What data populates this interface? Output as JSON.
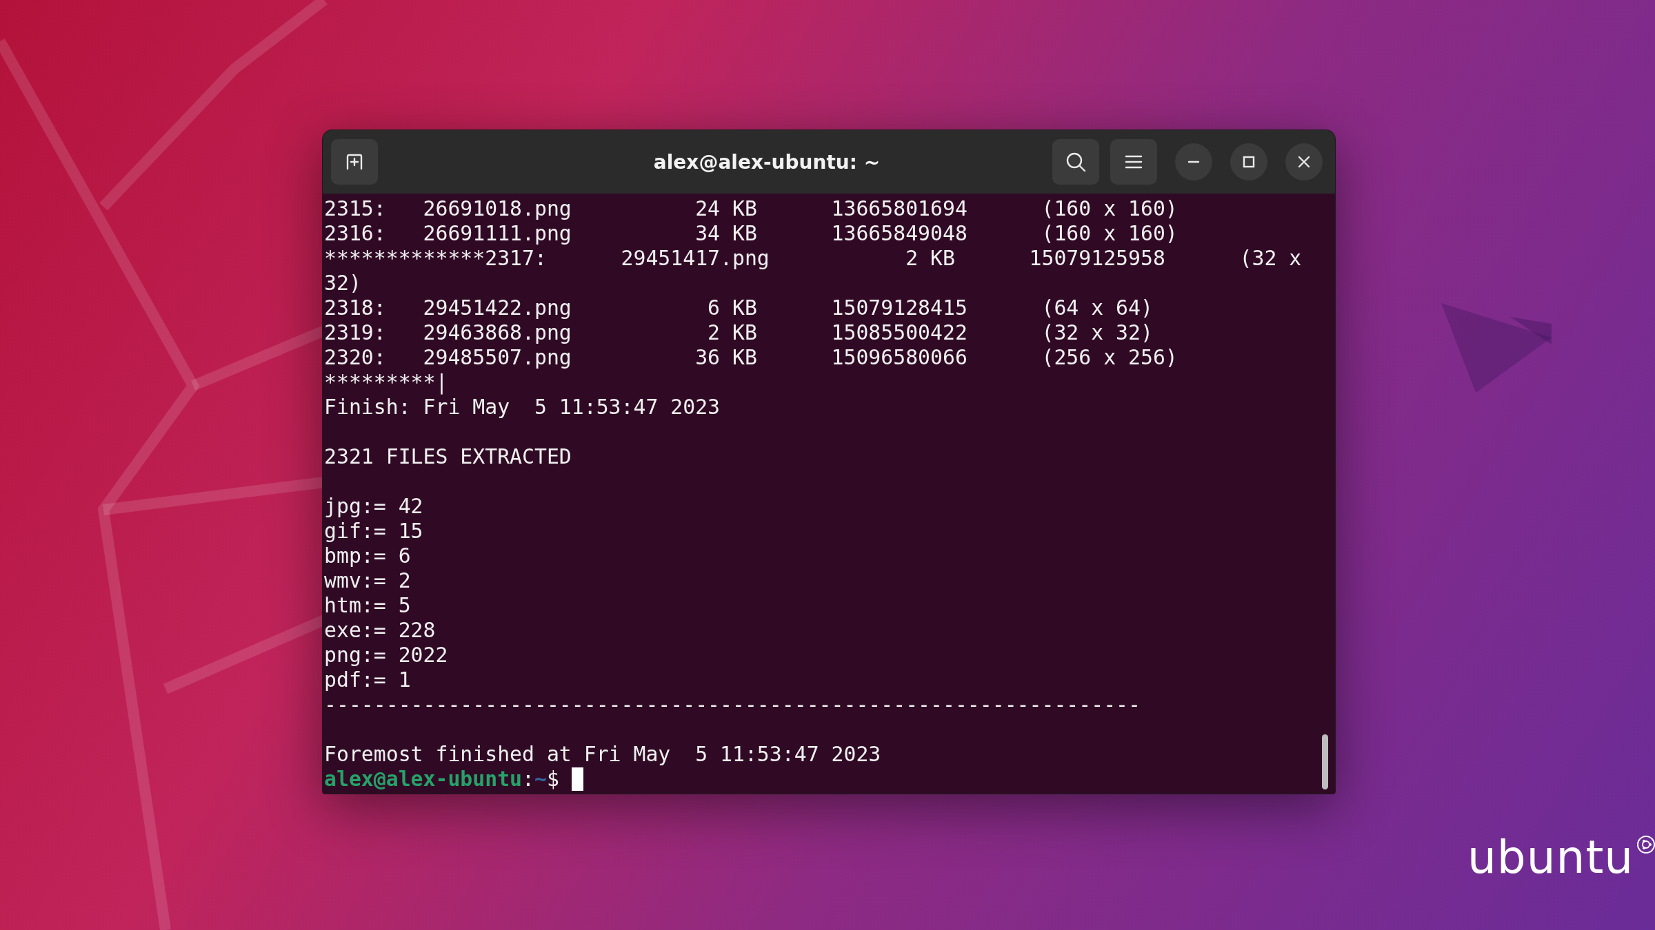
{
  "window": {
    "title": "alex@alex-ubuntu: ~"
  },
  "terminal": {
    "lines": [
      {
        "kind": "text",
        "text": "2315:   26691018.png          24 KB      13665801694      (160 x 160)"
      },
      {
        "kind": "text",
        "text": "2316:   26691111.png          34 KB      13665849048      (160 x 160)"
      },
      {
        "kind": "text",
        "text": "*************2317:      29451417.png           2 KB      15079125958      (32 x"
      },
      {
        "kind": "text",
        "text": "32)"
      },
      {
        "kind": "text",
        "text": "2318:   29451422.png           6 KB      15079128415      (64 x 64)"
      },
      {
        "kind": "text",
        "text": "2319:   29463868.png           2 KB      15085500422      (32 x 32)"
      },
      {
        "kind": "text",
        "text": "2320:   29485507.png          36 KB      15096580066      (256 x 256)"
      },
      {
        "kind": "text",
        "text": "*********|"
      },
      {
        "kind": "text",
        "text": "Finish: Fri May  5 11:53:47 2023"
      },
      {
        "kind": "blank"
      },
      {
        "kind": "text",
        "text": "2321 FILES EXTRACTED"
      },
      {
        "kind": "blank"
      },
      {
        "kind": "text",
        "text": "jpg:= 42"
      },
      {
        "kind": "text",
        "text": "gif:= 15"
      },
      {
        "kind": "text",
        "text": "bmp:= 6"
      },
      {
        "kind": "text",
        "text": "wmv:= 2"
      },
      {
        "kind": "text",
        "text": "htm:= 5"
      },
      {
        "kind": "text",
        "text": "exe:= 228"
      },
      {
        "kind": "text",
        "text": "png:= 2022"
      },
      {
        "kind": "text",
        "text": "pdf:= 1"
      },
      {
        "kind": "text",
        "text": "------------------------------------------------------------------"
      },
      {
        "kind": "blank"
      },
      {
        "kind": "text",
        "text": "Foremost finished at Fri May  5 11:53:47 2023"
      }
    ],
    "prompt": {
      "user_host": "alex@alex-ubuntu",
      "separator": ":",
      "path": "~",
      "symbol": "$",
      "cursor_visible": true
    }
  },
  "desktop": {
    "logo_text": "ubuntu"
  }
}
